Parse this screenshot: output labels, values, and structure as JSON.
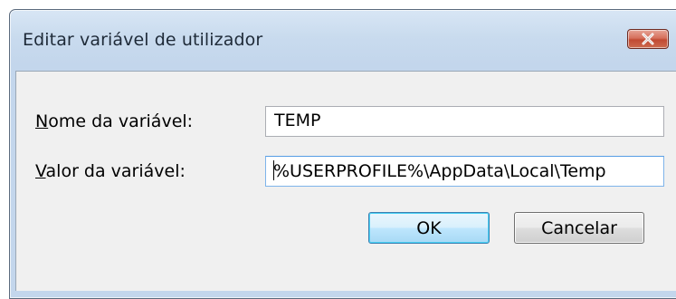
{
  "dialog": {
    "title": "Editar variável de utilizador",
    "close_icon": "close-icon"
  },
  "form": {
    "name_label_accel": "N",
    "name_label_rest": "ome da variável:",
    "name_value": "TEMP",
    "value_label_accel": "V",
    "value_label_rest": "alor da variável:",
    "value_value": "%USERPROFILE%\\AppData\\Local\\Temp"
  },
  "buttons": {
    "ok_label": "OK",
    "cancel_label": "Cancelar"
  },
  "colors": {
    "frame": "#c3d6ec",
    "client": "#f0f0f0",
    "close_button": "#c14a33",
    "focus_border": "#569de5"
  }
}
